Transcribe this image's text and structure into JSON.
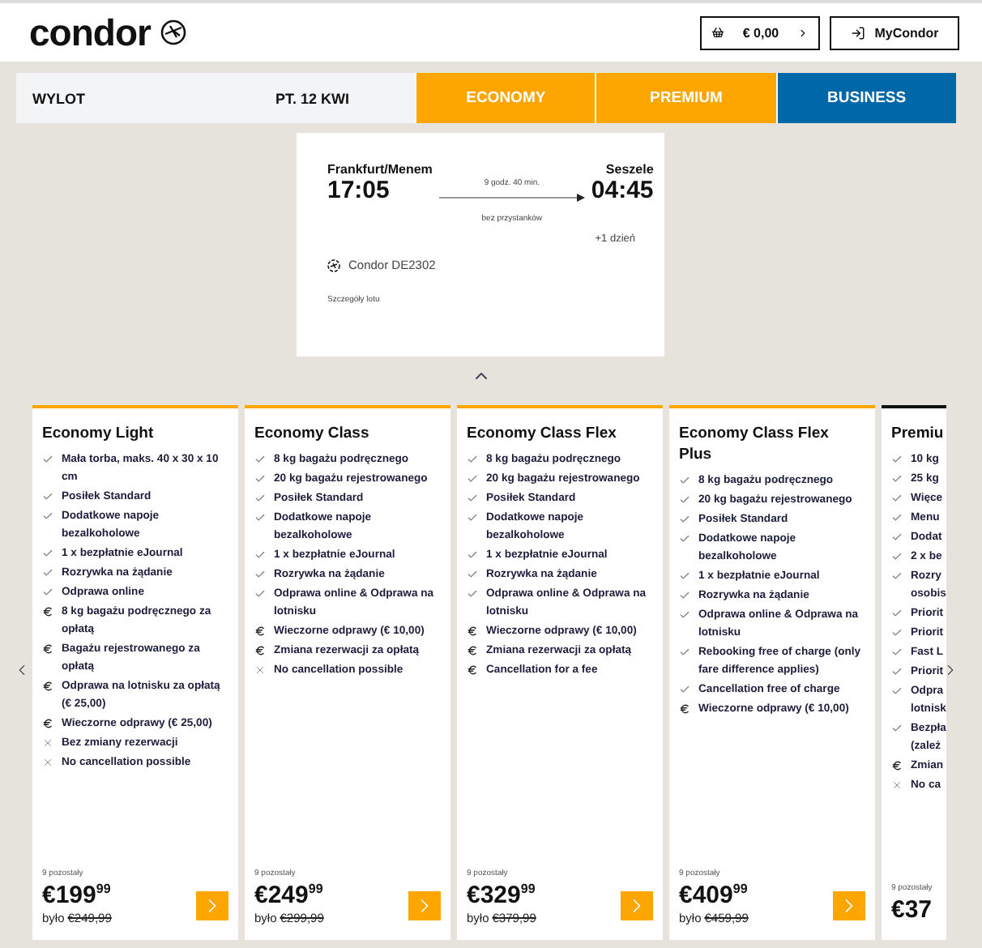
{
  "header": {
    "logo": "condor",
    "cart": {
      "amount": "€ 0,00"
    },
    "account_button": "MyCondor"
  },
  "fare_bar": {
    "label": "WYLOT",
    "date": "PT. 12 KWI",
    "tabs": [
      {
        "label": "ECONOMY",
        "color": "#fda500"
      },
      {
        "label": "PREMIUM",
        "color": "#fda500"
      },
      {
        "label": "BUSINESS",
        "color": "#0068a9"
      }
    ]
  },
  "flight": {
    "from_city": "Frankfurt/Menem",
    "from_time": "17:05",
    "duration": "9 godz. 40 min.",
    "stops": "bez przystanków",
    "to_city": "Seszele",
    "to_time": "04:45",
    "day_offset": "+1 dzień",
    "flight_number": "Condor DE2302",
    "details_link": "Szczegóły lotu"
  },
  "fares": [
    {
      "title": "Economy Light",
      "color": "#fda500",
      "items": [
        {
          "kind": "included",
          "text": "Mała torba, maks. 40 x 30 x 10 cm"
        },
        {
          "kind": "included",
          "text": "Posiłek Standard"
        },
        {
          "kind": "included",
          "text": "Dodatkowe napoje bezalkoholowe"
        },
        {
          "kind": "included",
          "text": "1 x bezpłatnie eJournal"
        },
        {
          "kind": "included",
          "text": "Rozrywka na żądanie"
        },
        {
          "kind": "included",
          "text": "Odprawa online"
        },
        {
          "kind": "paid",
          "text": "8 kg bagażu podręcznego za opłatą"
        },
        {
          "kind": "paid",
          "text": "Bagażu rejestrowanego za opłatą"
        },
        {
          "kind": "paid",
          "text": "Odprawa na lotnisku za opłatą (€ 25,00)"
        },
        {
          "kind": "paid",
          "text": "Wieczorne odprawy (€ 25,00)"
        },
        {
          "kind": "excluded",
          "text": "Bez zmiany rezerwacji"
        },
        {
          "kind": "excluded",
          "text": "No cancellation possible"
        }
      ],
      "remaining": "9 pozostały",
      "price": "€199",
      "cents": "99",
      "was_label": "było",
      "was_price": "€249,99"
    },
    {
      "title": "Economy Class",
      "color": "#fda500",
      "items": [
        {
          "kind": "included",
          "text": "8 kg bagażu podręcznego"
        },
        {
          "kind": "included",
          "text": "20 kg bagażu rejestrowanego"
        },
        {
          "kind": "included",
          "text": "Posiłek Standard"
        },
        {
          "kind": "included",
          "text": "Dodatkowe napoje bezalkoholowe"
        },
        {
          "kind": "included",
          "text": "1 x bezpłatnie eJournal"
        },
        {
          "kind": "included",
          "text": "Rozrywka na żądanie"
        },
        {
          "kind": "included",
          "text": "Odprawa online & Odprawa na lotnisku"
        },
        {
          "kind": "paid",
          "text": "Wieczorne odprawy (€ 10,00)"
        },
        {
          "kind": "paid",
          "text": "Zmiana rezerwacji za opłatą"
        },
        {
          "kind": "excluded",
          "text": "No cancellation possible"
        }
      ],
      "remaining": "9 pozostały",
      "price": "€249",
      "cents": "99",
      "was_label": "było",
      "was_price": "€299,99"
    },
    {
      "title": "Economy Class Flex",
      "color": "#fda500",
      "items": [
        {
          "kind": "included",
          "text": "8 kg bagażu podręcznego"
        },
        {
          "kind": "included",
          "text": "20 kg bagażu rejestrowanego"
        },
        {
          "kind": "included",
          "text": "Posiłek Standard"
        },
        {
          "kind": "included",
          "text": "Dodatkowe napoje bezalkoholowe"
        },
        {
          "kind": "included",
          "text": "1 x bezpłatnie eJournal"
        },
        {
          "kind": "included",
          "text": "Rozrywka na żądanie"
        },
        {
          "kind": "included",
          "text": "Odprawa online & Odprawa na lotnisku"
        },
        {
          "kind": "paid",
          "text": "Wieczorne odprawy (€ 10,00)"
        },
        {
          "kind": "paid",
          "text": "Zmiana rezerwacji za opłatą"
        },
        {
          "kind": "paid",
          "text": "Cancellation for a fee"
        }
      ],
      "remaining": "9 pozostały",
      "price": "€329",
      "cents": "99",
      "was_label": "było",
      "was_price": "€379,99"
    },
    {
      "title": "Economy Class Flex Plus",
      "color": "#fda500",
      "items": [
        {
          "kind": "included",
          "text": "8 kg bagażu podręcznego"
        },
        {
          "kind": "included",
          "text": "20 kg bagażu rejestrowanego"
        },
        {
          "kind": "included",
          "text": "Posiłek Standard"
        },
        {
          "kind": "included",
          "text": "Dodatkowe napoje bezalkoholowe"
        },
        {
          "kind": "included",
          "text": "1 x bezpłatnie eJournal"
        },
        {
          "kind": "included",
          "text": "Rozrywka na żądanie"
        },
        {
          "kind": "included",
          "text": "Odprawa online & Odprawa na lotnisku"
        },
        {
          "kind": "included",
          "text": "Rebooking free of charge (only fare difference applies)"
        },
        {
          "kind": "included",
          "text": "Cancellation free of charge"
        },
        {
          "kind": "paid",
          "text": "Wieczorne odprawy (€ 10,00)"
        }
      ],
      "remaining": "9 pozostały",
      "price": "€409",
      "cents": "99",
      "was_label": "było",
      "was_price": "€459,99"
    },
    {
      "title": "Premiu",
      "color": "#111111",
      "items": [
        {
          "kind": "included",
          "text": "10 kg"
        },
        {
          "kind": "included",
          "text": "25 kg"
        },
        {
          "kind": "included",
          "text": "Więce"
        },
        {
          "kind": "included",
          "text": "Menu"
        },
        {
          "kind": "included",
          "text": "Dodat"
        },
        {
          "kind": "included",
          "text": "2 x be"
        },
        {
          "kind": "included",
          "text": "Rozry\nosobis"
        },
        {
          "kind": "included",
          "text": "Priorit"
        },
        {
          "kind": "included",
          "text": "Priorit"
        },
        {
          "kind": "included",
          "text": "Fast L"
        },
        {
          "kind": "included",
          "text": "Priorit"
        },
        {
          "kind": "included",
          "text": "Odpra\nlotnisk"
        },
        {
          "kind": "included",
          "text": "Bezpła\n(zależ"
        },
        {
          "kind": "paid",
          "text": "Zmian"
        },
        {
          "kind": "excluded",
          "text": "No ca"
        }
      ],
      "remaining": "9 pozostały",
      "price": "€37"
    }
  ]
}
